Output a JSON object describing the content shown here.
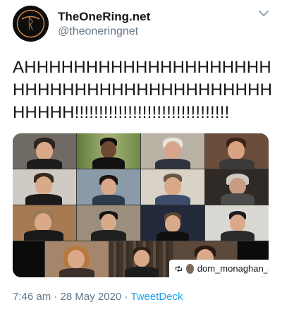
{
  "account": {
    "display_name": "TheOneRing.net",
    "handle": "@theoneringnet",
    "avatar_icon": "ring-logo-icon"
  },
  "menu": {
    "icon": "chevron-down-icon"
  },
  "tweet": {
    "text": "AHHHHHHHHHHHHHHHHHHHHHHHHHHHHHHHHHHHHHHHHHHHHHH!!!!!!!!!!!!!!!!!!!!!!!!!!!!!!!!"
  },
  "media": {
    "type": "video-call-grid",
    "credit_icon": "retweet-icon",
    "credit_text": "dom_monaghan_"
  },
  "meta": {
    "time": "7:46 am",
    "sep1": "·",
    "date": "28 May 2020",
    "sep2": "·",
    "via": "TweetDeck"
  },
  "colors": {
    "text": "#14171a",
    "muted": "#657786",
    "link": "#1da1f2"
  }
}
